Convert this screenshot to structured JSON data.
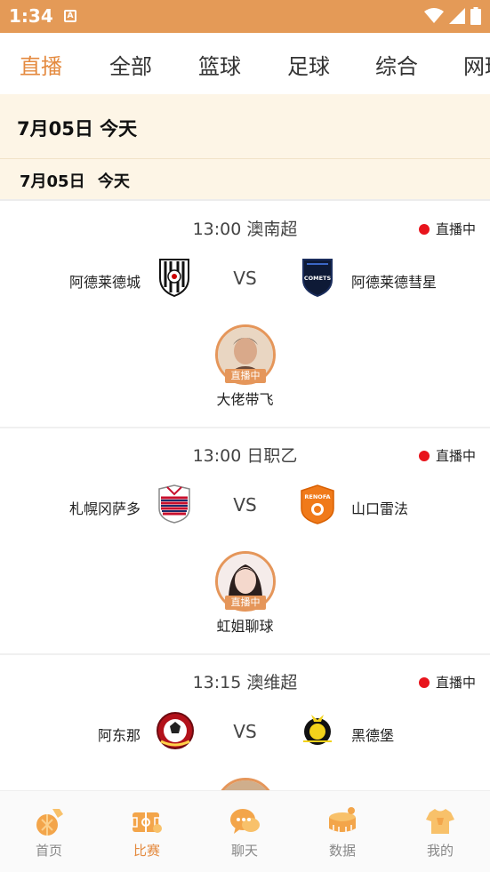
{
  "status_bar": {
    "time": "1:34",
    "notification_glyph": "A"
  },
  "tabs": [
    {
      "label": "直播",
      "active": true
    },
    {
      "label": "全部",
      "active": false
    },
    {
      "label": "篮球",
      "active": false
    },
    {
      "label": "足球",
      "active": false
    },
    {
      "label": "综合",
      "active": false
    },
    {
      "label": "网球",
      "active": false
    }
  ],
  "date_header": {
    "main": "7月05日 今天",
    "sub": "7月05日 今天"
  },
  "matches": [
    {
      "time_league": "13:00 澳南超",
      "live_label": "直播中",
      "home_team": "阿德莱德城",
      "away_team": "阿德莱德彗星",
      "vs": "VS",
      "away_logo_text": "COMETS",
      "anchor_live": "直播中",
      "anchor_name": "大佬带飞"
    },
    {
      "time_league": "13:00 日职乙",
      "live_label": "直播中",
      "home_team": "札幌冈萨多",
      "away_team": "山口雷法",
      "vs": "VS",
      "away_logo_text": "RENOFA",
      "anchor_live": "直播中",
      "anchor_name": "虹姐聊球"
    },
    {
      "time_league": "13:15 澳维超",
      "live_label": "直播中",
      "home_team": "阿东那",
      "away_team": "黑德堡",
      "vs": "VS"
    }
  ],
  "bottom_nav": [
    {
      "label": "首页",
      "icon": "home-icon",
      "active": false
    },
    {
      "label": "比赛",
      "icon": "match-field-icon",
      "active": true
    },
    {
      "label": "聊天",
      "icon": "chat-icon",
      "active": false
    },
    {
      "label": "数据",
      "icon": "data-stadium-icon",
      "active": false
    },
    {
      "label": "我的",
      "icon": "jersey-icon",
      "active": false
    }
  ],
  "colors": {
    "accent": "#e48a3f",
    "status_bar": "#e49a57",
    "live_dot": "#e8141c",
    "date_bg": "#fdf5e6"
  }
}
